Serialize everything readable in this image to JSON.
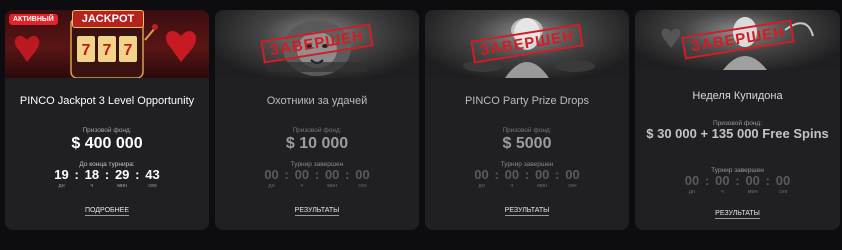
{
  "cards": [
    {
      "badge": "АКТИВНЫЙ",
      "banner_text": "JACKPOT",
      "title": "PINCO Jackpot 3 Level Opportunity",
      "prize_label": "Призовой фонд:",
      "prize_value": "$ 400 000",
      "timer_label": "До конца турнира:",
      "timer": [
        {
          "value": "19",
          "unit": "дн"
        },
        {
          "value": "18",
          "unit": "ч"
        },
        {
          "value": "29",
          "unit": "мин"
        },
        {
          "value": "43",
          "unit": "сек"
        }
      ],
      "action": "ПОДРОБНЕЕ"
    },
    {
      "stamp": "ЗАВЕРШЕН",
      "title": "Охотники за удачей",
      "prize_label": "Призовой фонд:",
      "prize_value": "$ 10 000",
      "timer_label": "Турнир завершен",
      "timer": [
        {
          "value": "00",
          "unit": "дн"
        },
        {
          "value": "00",
          "unit": "ч"
        },
        {
          "value": "00",
          "unit": "мин"
        },
        {
          "value": "00",
          "unit": "сек"
        }
      ],
      "action": "РЕЗУЛЬТАТЫ"
    },
    {
      "stamp": "ЗАВЕРШЕН",
      "title": "PINCO Party Prize Drops",
      "prize_label": "Призовой фонд:",
      "prize_value": "$ 5000",
      "timer_label": "Турнир завершен",
      "timer": [
        {
          "value": "00",
          "unit": "дн"
        },
        {
          "value": "00",
          "unit": "ч"
        },
        {
          "value": "00",
          "unit": "мин"
        },
        {
          "value": "00",
          "unit": "сек"
        }
      ],
      "action": "РЕЗУЛЬТАТЫ"
    },
    {
      "stamp": "ЗАВЕРШЕН",
      "title": "Неделя Купидона",
      "prize_label": "Призовой фонд:",
      "prize_value": "$ 30 000 + 135 000 Free Spins",
      "timer_label": "Турнир завершен",
      "timer": [
        {
          "value": "00",
          "unit": "дн"
        },
        {
          "value": "00",
          "unit": "ч"
        },
        {
          "value": "00",
          "unit": "мин"
        },
        {
          "value": "00",
          "unit": "сек"
        }
      ],
      "action": "РЕЗУЛЬТАТЫ"
    }
  ],
  "colors": {
    "background": "#0d0d0f",
    "card": "#202024",
    "active_badge": "#e3232a",
    "stamp": "#d41c24"
  },
  "icons": {
    "card1_banner": "slot-machine-image",
    "card2_banner": "lion-image",
    "card3_banner": "woman-party-image",
    "card4_banner": "cupid-woman-image"
  }
}
